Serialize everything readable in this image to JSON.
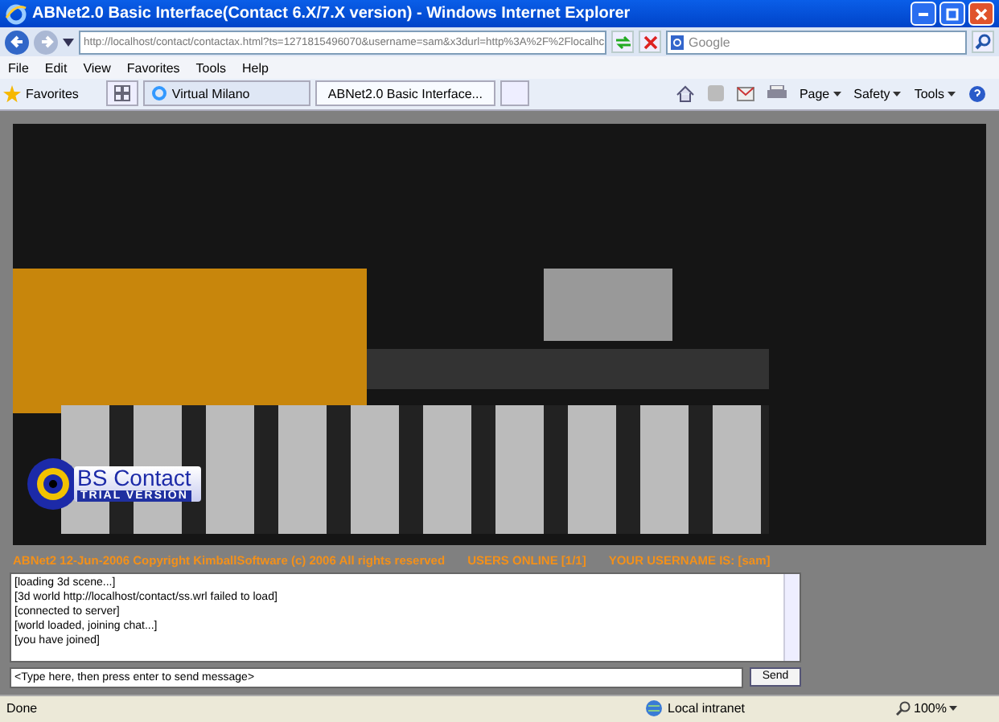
{
  "window": {
    "title": "ABNet2.0 Basic Interface(Contact 6.X/7.X version) - Windows Internet Explorer"
  },
  "address_bar": {
    "value": "http://localhost/contact/contactax.html?ts=1271815496070&username=sam&x3durl=http%3A%2F%2Flocalhc"
  },
  "search": {
    "placeholder": "Google"
  },
  "menu": [
    "File",
    "Edit",
    "View",
    "Favorites",
    "Tools",
    "Help"
  ],
  "favorites_label": "Favorites",
  "tabs": [
    {
      "label": "Virtual Milano",
      "selected": false
    },
    {
      "label": "ABNet2.0 Basic Interface...",
      "selected": true
    }
  ],
  "command_bar": [
    "Page",
    "Safety",
    "Tools"
  ],
  "viewer": {
    "logo_title": "BS Contact",
    "logo_subtitle": "TRIAL VERSION"
  },
  "info_line": [
    "ABNet2 12-Jun-2006 Copyright KimballSoftware (c) 2006 All rights reserved",
    "USERS ONLINE [1/1]",
    "YOUR USERNAME IS: [sam]"
  ],
  "chat_log": [
    "[loading 3d scene...]",
    "[3d world http://localhost/contact/ss.wrl failed to load]",
    "[connected to server]",
    "[world loaded, joining chat...]",
    "[you have joined]"
  ],
  "message_input": {
    "value": "<Type here, then press enter to send message>"
  },
  "send_button": "Send",
  "status_bar": {
    "status": "Done",
    "zone": "Local intranet",
    "zoom": "100%"
  }
}
